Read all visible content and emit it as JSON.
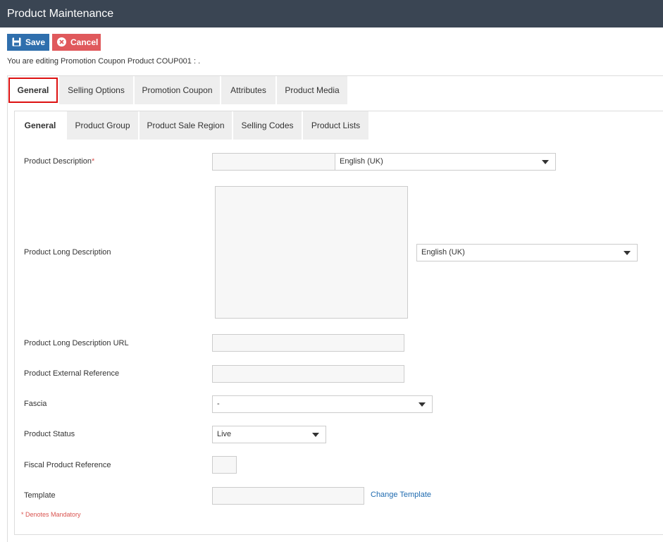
{
  "window": {
    "title": "Product Maintenance"
  },
  "toolbar": {
    "save_label": "Save",
    "cancel_label": "Cancel"
  },
  "editing_text": "You are editing Promotion Coupon Product COUP001 : .",
  "main_tabs": [
    {
      "label": "General",
      "active": true
    },
    {
      "label": "Selling Options"
    },
    {
      "label": "Promotion Coupon"
    },
    {
      "label": "Attributes"
    },
    {
      "label": "Product Media"
    }
  ],
  "sub_tabs": [
    {
      "label": "General",
      "active": true
    },
    {
      "label": "Product Group"
    },
    {
      "label": "Product Sale Region"
    },
    {
      "label": "Selling Codes"
    },
    {
      "label": "Product Lists"
    }
  ],
  "form": {
    "product_description": {
      "label": "Product Description",
      "required_mark": "*",
      "value": "",
      "language": "English (UK)"
    },
    "product_long_description": {
      "label": "Product Long Description",
      "value": "",
      "language": "English (UK)"
    },
    "product_long_description_url": {
      "label": "Product Long Description URL",
      "value": ""
    },
    "product_external_reference": {
      "label": "Product External Reference",
      "value": ""
    },
    "fascia": {
      "label": "Fascia",
      "value": "-"
    },
    "product_status": {
      "label": "Product Status",
      "value": "Live"
    },
    "fiscal_product_reference": {
      "label": "Fiscal Product Reference",
      "value": ""
    },
    "template": {
      "label": "Template",
      "value": "",
      "change_link": "Change Template"
    }
  },
  "mandatory_note": "* Denotes Mandatory",
  "colors": {
    "titlebar": "#3a4553",
    "save": "#2f6fad",
    "cancel": "#e0595c",
    "highlight": "#dd1111",
    "link": "#1f6bb0"
  }
}
